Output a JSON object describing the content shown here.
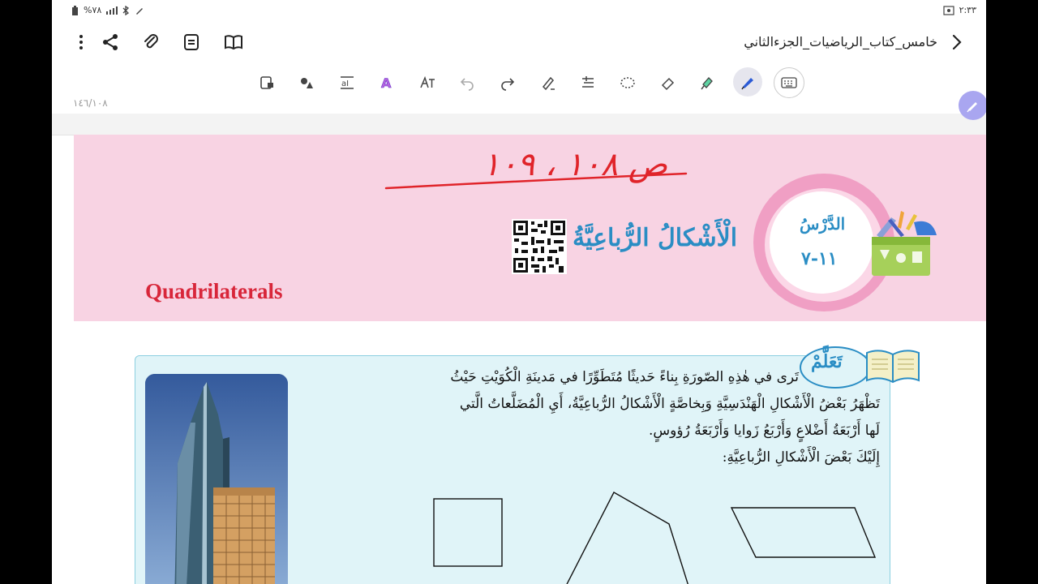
{
  "status": {
    "battery": "%٧٨",
    "time": "٢:٣٣"
  },
  "header": {
    "doc_title": "خامس_كتاب_الرياضيات_الجزءالثاني"
  },
  "toolbar": {
    "tools": [
      "lock-icon",
      "shapes-icon",
      "text-box-icon",
      "text-style-icon",
      "handwriting-text-icon",
      "undo-icon",
      "redo-icon",
      "pen-settings-icon",
      "spacing-icon",
      "lasso-icon",
      "eraser-icon",
      "highlighter-icon",
      "pen-icon",
      "keyboard-icon"
    ],
    "active_tool": "pen-icon"
  },
  "page": {
    "page_number": "١٤٦/١٠٨",
    "handwritten_note": "ص ١٠٨ ، ١٠٩",
    "lesson_label": "الدَّرْسُ",
    "lesson_number": "١١-٧",
    "lesson_title": "الْأَشْكالُ الرُّباعِيَّةُ",
    "english_title": "Quadrilaterals",
    "learn_label": "تَعَلَّمْ",
    "paragraph": [
      "تَرى في هٰذِهِ الصّورَةِ بِناءً حَديثًا مُتَطَوِّرًا في مَدينَةِ الْكُوَيْتِ حَيْثُ",
      "تَظْهَرُ بَعْضُ الْأَشْكالِ الْهَنْدَسِيَّةِ وَبِخاصَّةٍ الْأَشْكالُ الرُّباعِيَّةُ، أَيِ الْمُضَلَّعاتُ الَّتي",
      "لَها أَرْبَعَةُ أَضْلاعٍ وَأَرْبَعُ زَوايا وَأَرْبَعَةُ رُؤوسٍ.",
      "إِلَيْكَ بَعْضَ الْأَشْكالِ الرُّباعِيَّةِ:"
    ]
  },
  "colors": {
    "banner_pink": "#f8d3e3",
    "title_blue": "#2a8dc4",
    "english_red": "#d8263a",
    "learn_bg": "#e0f4f8",
    "annotation_red": "#e0242a"
  }
}
